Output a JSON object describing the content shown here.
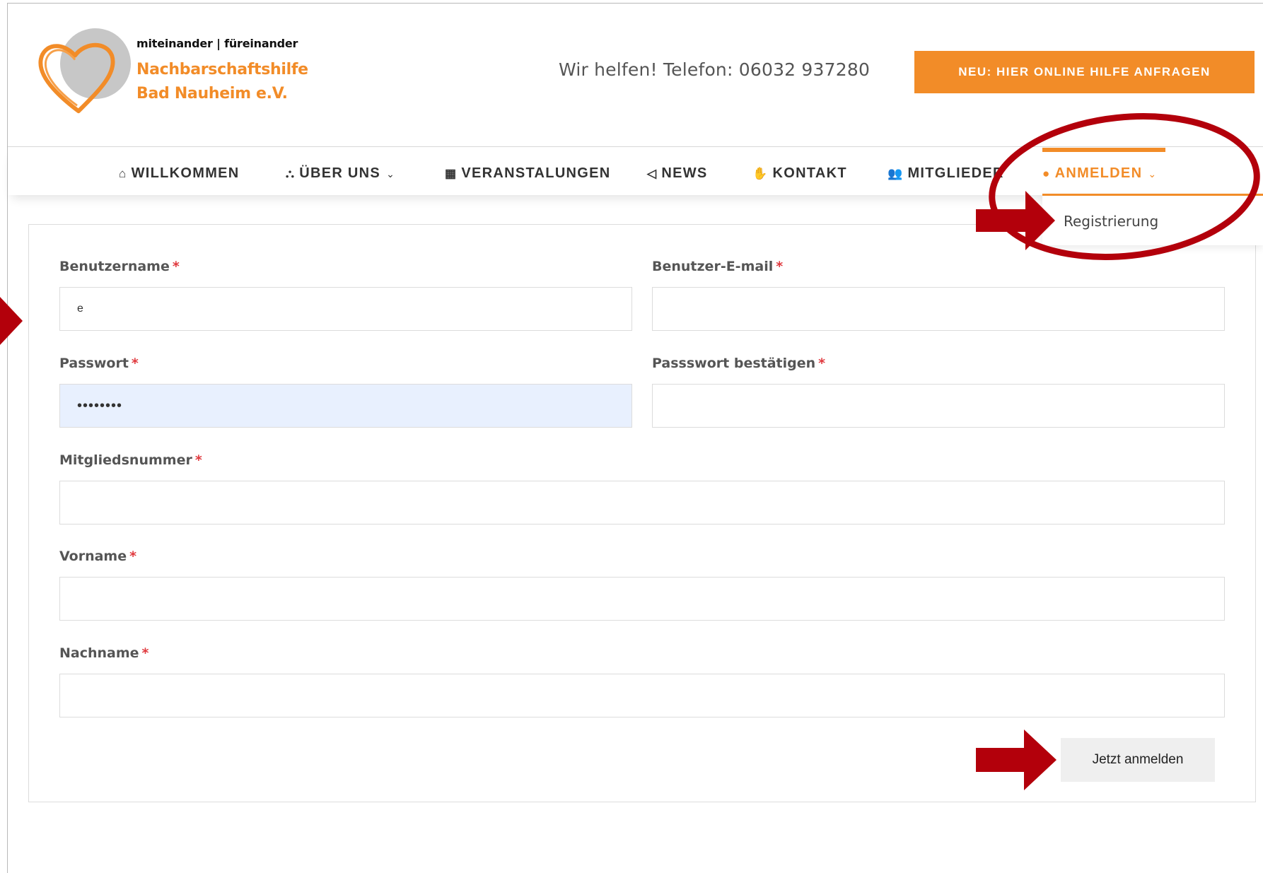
{
  "header": {
    "tagline": "miteinander | füreinander",
    "brand_line1": "Nachbarschaftshilfe",
    "brand_line2": "Bad Nauheim e.V.",
    "phone": "Wir helfen! Telefon: 06032 937280",
    "cta_label": "NEU: HIER ONLINE HILFE ANFRAGEN"
  },
  "nav": {
    "items": [
      {
        "label": "WILLKOMMEN",
        "icon": "home-icon"
      },
      {
        "label": "ÜBER UNS",
        "icon": "sitemap-icon"
      },
      {
        "label": "VERANSTALUNGEN",
        "icon": "calendar-icon"
      },
      {
        "label": "NEWS",
        "icon": "megaphone-icon"
      },
      {
        "label": "KONTAKT",
        "icon": "handshake-icon"
      },
      {
        "label": "MITGLIEDER",
        "icon": "users-icon"
      },
      {
        "label": "ANMELDEN",
        "icon": "user-icon"
      }
    ],
    "dropdown_item": "Registrierung"
  },
  "form": {
    "username_label": "Benutzername",
    "username_value": "e",
    "email_label": "Benutzer-E-mail",
    "email_value": "",
    "password_label": "Passwort",
    "password_value": "••••••••",
    "confirm_label": "Passswort bestätigen",
    "confirm_value": "",
    "member_label": "Mitgliedsnummer",
    "member_value": "",
    "firstname_label": "Vorname",
    "firstname_value": "",
    "lastname_label": "Nachname",
    "lastname_value": "",
    "required_mark": "*",
    "submit_label": "Jetzt anmelden"
  },
  "colors": {
    "accent": "#f28c28",
    "required": "#e0393e",
    "annotation": "#b3000b"
  }
}
